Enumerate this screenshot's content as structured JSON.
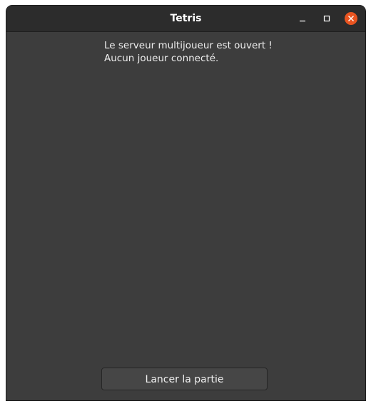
{
  "window": {
    "title": "Tetris",
    "controls": {
      "minimize_icon": "minimize-icon",
      "maximize_icon": "maximize-icon",
      "close_icon": "close-icon",
      "close_color": "#e95420"
    }
  },
  "status": {
    "line1": "Le serveur multijoueur est ouvert !",
    "line2": "Aucun joueur connecté."
  },
  "actions": {
    "launch_label": "Lancer la partie"
  },
  "colors": {
    "background": "#3d3d3d",
    "titlebar": "#2c2c2c",
    "button": "#464646"
  }
}
